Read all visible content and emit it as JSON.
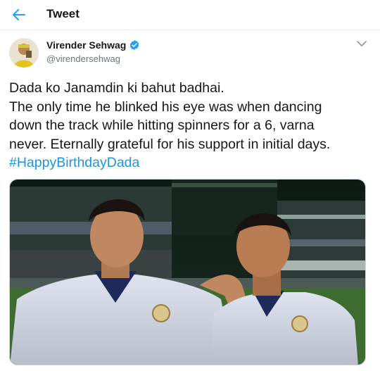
{
  "header": {
    "title": "Tweet",
    "back_icon": "back-arrow-icon"
  },
  "author": {
    "name": "Virender Sehwag",
    "handle": "@virendersehwag",
    "verified": true
  },
  "tweet": {
    "lines": [
      "Dada ko Janamdin ki bahut badhai.",
      "The only time he blinked his eye was when dancing",
      "down the track while hitting spinners for a 6, varna",
      "never. Eternally grateful for his support in initial days."
    ],
    "hashtag": "#HappyBirthdayDada"
  },
  "colors": {
    "accent": "#1da1f2",
    "hashtag": "#1b95e0",
    "secondary_text": "#657786",
    "border": "#e6ecf0"
  }
}
